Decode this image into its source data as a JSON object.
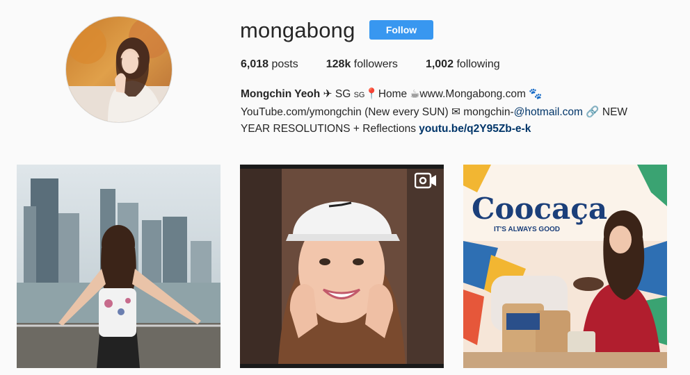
{
  "profile": {
    "username": "mongabong",
    "follow_label": "Follow"
  },
  "stats": {
    "posts_count": "6,018",
    "posts_label": "posts",
    "followers_count": "128k",
    "followers_label": "followers",
    "following_count": "1,002",
    "following_label": "following"
  },
  "bio": {
    "name": "Mongchin Yeoh",
    "line1_text": "SG",
    "flag_sg": "SG",
    "line1_home": "Home",
    "website": "www.Mongabong.com",
    "line2_youtube": "YouTube.com/ymongchin (New every SUN)",
    "email_prefix": "mongchin-",
    "email_link": "@hotmail.com",
    "line2_new": "NEW",
    "line3_text": "YEAR RESOLUTIONS + Reflections",
    "link": "youtu.be/q2Y95Zb-e-k"
  },
  "posts": {
    "post3_brand": "Coocaça",
    "post3_tagline": "IT'S ALWAYS GOOD"
  },
  "colors": {
    "follow_button": "#3897f0",
    "link": "#003569",
    "background": "#fafafa"
  }
}
